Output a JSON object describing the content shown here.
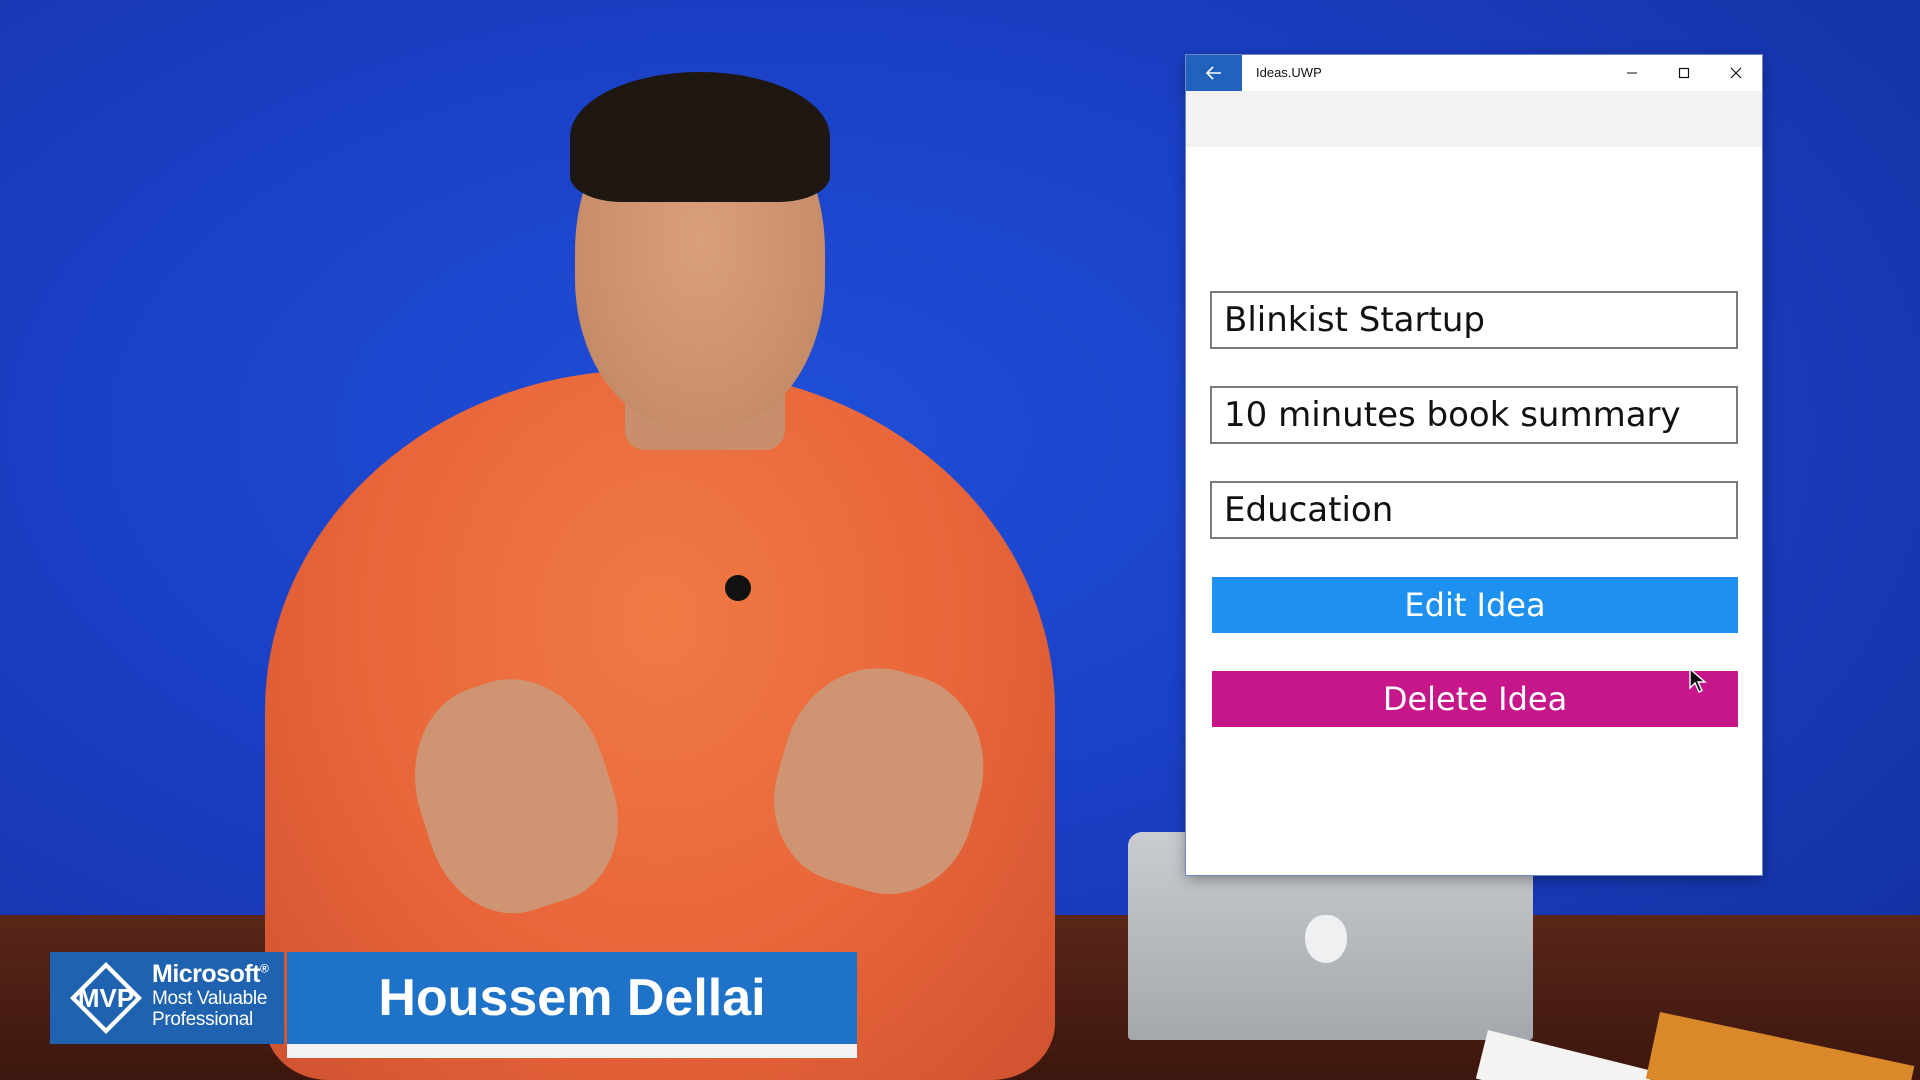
{
  "window": {
    "title": "Ideas.UWP",
    "back_icon": "back-arrow-icon",
    "minimize_icon": "minimize-icon",
    "maximize_icon": "maximize-icon",
    "close_icon": "close-icon"
  },
  "form": {
    "name_value": "Blinkist Startup",
    "description_value": "10 minutes book summary",
    "category_value": "Education",
    "edit_label": "Edit Idea",
    "delete_label": "Delete Idea"
  },
  "colors": {
    "accent_blue": "#1e90f0",
    "delete_magenta": "#c7158a",
    "titlebar_back": "#1f63bd"
  },
  "lower_third": {
    "mvp_logo_text": "MVP",
    "mvp_brand": "Microsoft",
    "mvp_registered": "®",
    "mvp_line2": "Most Valuable",
    "mvp_line3": "Professional",
    "presenter_name": "Houssem Dellai"
  }
}
